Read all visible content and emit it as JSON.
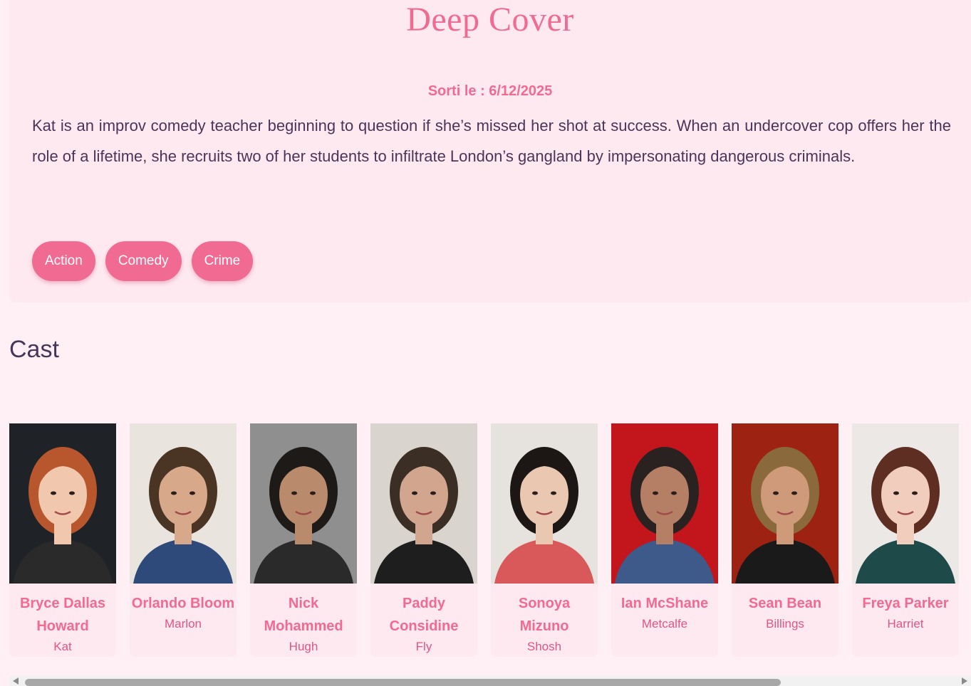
{
  "movie": {
    "title": "Deep Cover",
    "release": "Sorti le : 6/12/2025",
    "overview": "Kat is an improv comedy teacher beginning to question if she’s missed her shot at success. When an undercover cop offers her the role of a lifetime, she recruits two of her students to infiltrate London’s gangland by impersonating dangerous criminals.",
    "genres": [
      "Action",
      "Comedy",
      "Crime"
    ]
  },
  "cast": {
    "heading": "Cast",
    "members": [
      {
        "name": "Bryce Dallas Howard",
        "character": "Kat",
        "bg": "#1f2328",
        "skin": "#f1c7ad",
        "hair": "#b8572e",
        "shirt": "#2a2a2a"
      },
      {
        "name": "Orlando Bloom",
        "character": "Marlon",
        "bg": "#e9e4dd",
        "skin": "#d8a88a",
        "hair": "#4a3424",
        "shirt": "#2d4a7a"
      },
      {
        "name": "Nick Mohammed",
        "character": "Hugh",
        "bg": "#8f8f8f",
        "skin": "#b98a6b",
        "hair": "#1e1a18",
        "shirt": "#2a2a2a"
      },
      {
        "name": "Paddy Considine",
        "character": "Fly",
        "bg": "#d9d4cd",
        "skin": "#d2a58e",
        "hair": "#3a2e25",
        "shirt": "#1e1e1e"
      },
      {
        "name": "Sonoya Mizuno",
        "character": "Shosh",
        "bg": "#e6e3de",
        "skin": "#e9c7b1",
        "hair": "#1c1614",
        "shirt": "#d9585a"
      },
      {
        "name": "Ian McShane",
        "character": "Metcalfe",
        "bg": "#c2161c",
        "skin": "#b57f66",
        "hair": "#2a2220",
        "shirt": "#3d5a8a"
      },
      {
        "name": "Sean Bean",
        "character": "Billings",
        "bg": "#9e2212",
        "skin": "#cf9a7a",
        "hair": "#8a6a3c",
        "shirt": "#1a1a1a"
      },
      {
        "name": "Freya Parker",
        "character": "Harriet",
        "bg": "#ece8e6",
        "skin": "#f0cdbd",
        "hair": "#5e2e22",
        "shirt": "#1f4a4a"
      }
    ]
  }
}
